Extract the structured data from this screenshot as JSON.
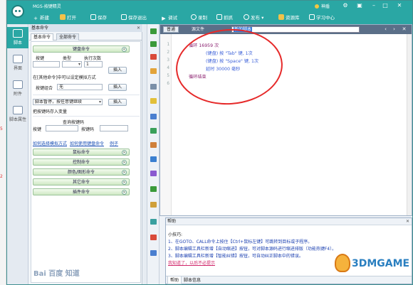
{
  "app": {
    "title": "MGS-按键精灵",
    "member_label": "神盾"
  },
  "toolbar": {
    "new": "新建",
    "open": "打开",
    "save": "保存",
    "save_exit": "保存退出",
    "debug": "调试",
    "record": "录制",
    "capture": "抓抓",
    "publish": "发布",
    "resources": "资源库",
    "learn": "学习中心"
  },
  "vnav": [
    {
      "label": "脚本"
    },
    {
      "label": "界面"
    },
    {
      "label": "附件"
    },
    {
      "label": "脚本属性"
    }
  ],
  "left_strip": [
    "5",
    "2"
  ],
  "cmd_panel": {
    "title": "基本命令",
    "tabs": [
      "基本命令",
      "全部命令"
    ],
    "keyboard_group": "键盘命令",
    "headers": {
      "key": "按键",
      "type": "类型",
      "count": "执行次数"
    },
    "count_value": "1",
    "insert": "插入",
    "hint": "在[其他命令]中可以设定模拟方式",
    "combo_label": "按键组合",
    "combo_value": "无",
    "pause_label": "脚本暂停，按任意键继续",
    "save_var_label": "把按键码存入变量",
    "query_title": "查询按键码",
    "query_key_label": "按键",
    "query_code_label": "按键码",
    "links": [
      "如何选择模拟方式",
      "如何使用键盘命令",
      "例子"
    ],
    "groups": [
      "鼠标命令",
      "控制命令",
      "颜色/图形命令",
      "其它命令",
      "插件命令"
    ]
  },
  "editor": {
    "tab_normal": "普通",
    "tab_source": "源文件",
    "script_name": "新的脚本",
    "lines": [
      {
        "n": "1",
        "text": "循环 16959 次",
        "kind": "kw"
      },
      {
        "n": "2",
        "text": "(键盘) 按 \"Tab\" 键, 1次",
        "kind": "cmd"
      },
      {
        "n": "3",
        "text": "(键盘) 按 \"Space\" 键, 1次",
        "kind": "cmd"
      },
      {
        "n": "4",
        "text": "延时 30000 毫秒",
        "kind": "cmd"
      },
      {
        "n": "5",
        "text": "循环结束",
        "kind": "kw"
      },
      {
        "n": "6",
        "text": "",
        "kind": "cmd"
      }
    ]
  },
  "help": {
    "title": "帮助",
    "heading": "小技巧:",
    "tips": [
      "1、在GOTO、CALL命令上按住【Ctrl+鼠标左键】可跳转到目标或子程序。",
      "2、脚本编辑工具栏新增【自动缩进】按钮，可对脚本源码进行缩进排版（功能热键F4）。",
      "3、脚本编辑工具栏新增【智能纠错】按钮，可自动纠正脚本中的错误。"
    ],
    "dismiss": "我知道了，以后不必提示",
    "tabs": [
      "帮助",
      "脚本信息"
    ]
  },
  "watermarks": {
    "baidu": "Bai 百度 知道",
    "site": "3DMGAME"
  },
  "colors": {
    "accent": "#2aa7a4",
    "link": "#1a4fb5",
    "annotation": "#e62a2a"
  }
}
